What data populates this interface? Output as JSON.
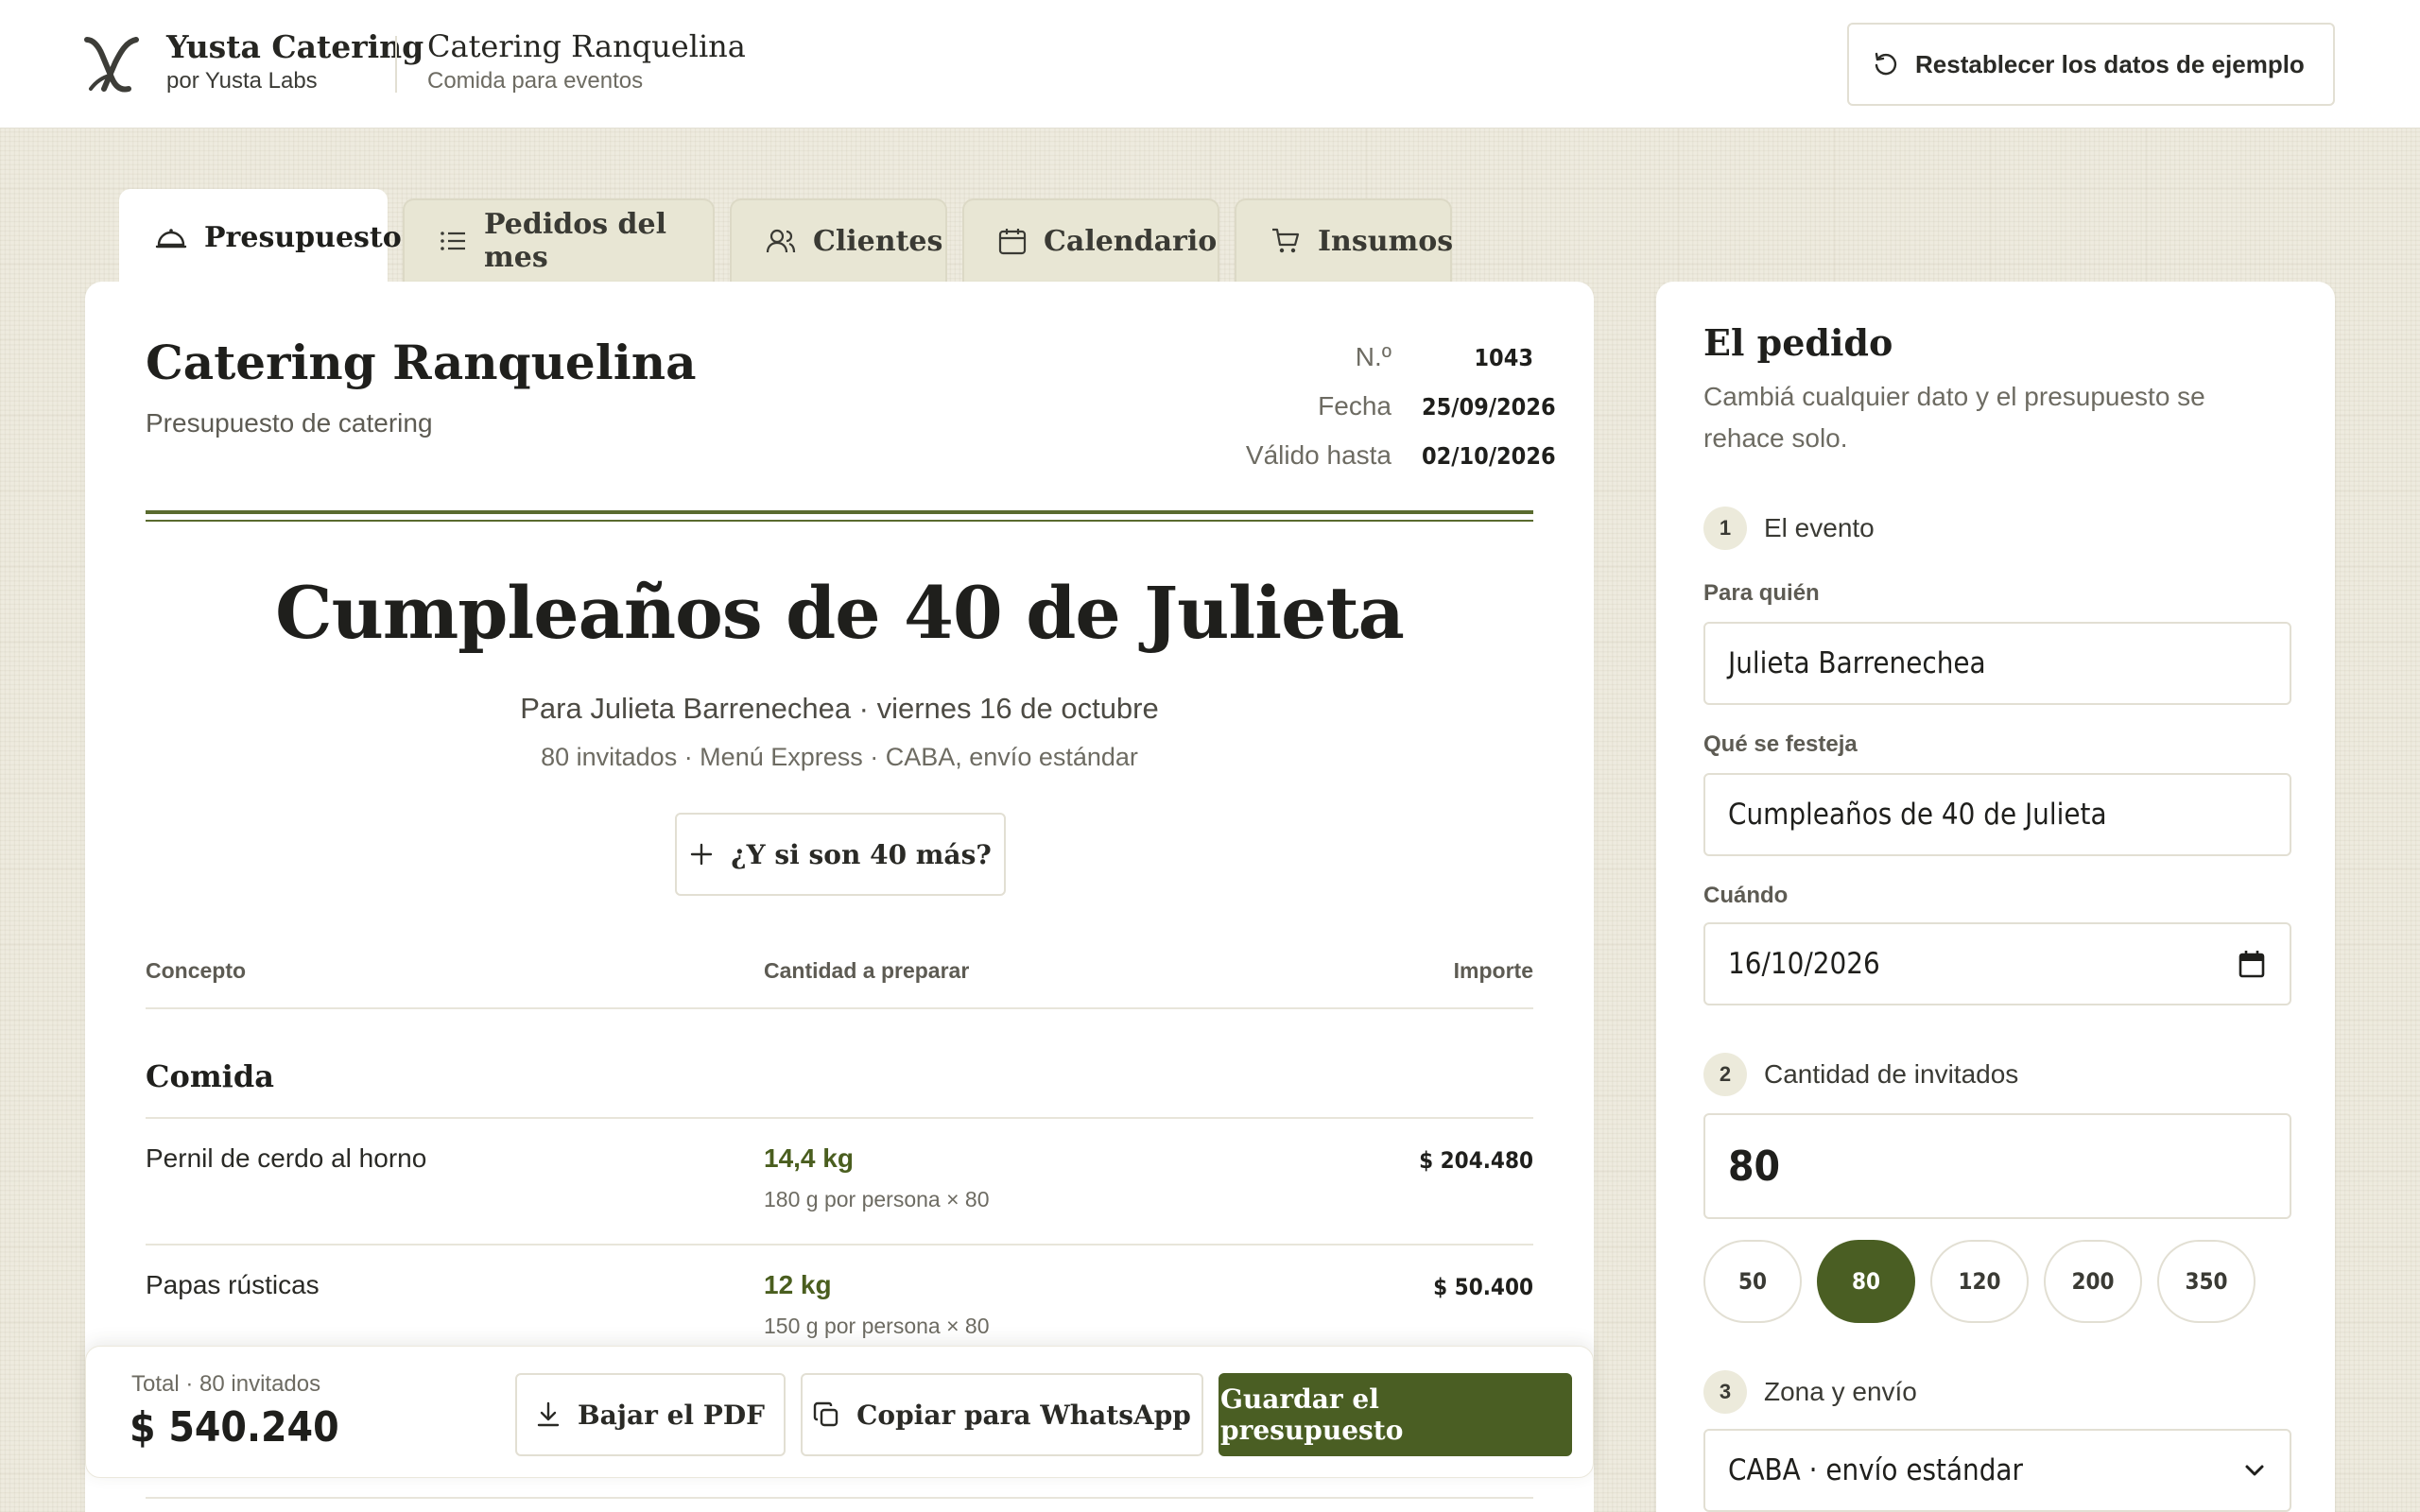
{
  "brand": {
    "name": "Yusta Catering",
    "by": "por Yusta Labs"
  },
  "app": {
    "title": "Catering Ranquelina",
    "subtitle": "Comida para eventos"
  },
  "reset_label": "Restablecer los datos de ejemplo",
  "tabs": [
    {
      "label": "Presupuesto",
      "icon": "cloche-icon",
      "active": true
    },
    {
      "label": "Pedidos del mes",
      "icon": "list-icon",
      "active": false
    },
    {
      "label": "Clientes",
      "icon": "users-icon",
      "active": false
    },
    {
      "label": "Calendario",
      "icon": "calendar-icon",
      "active": false
    },
    {
      "label": "Insumos",
      "icon": "cart-icon",
      "active": false
    }
  ],
  "quote": {
    "company": "Catering Ranquelina",
    "doc_type": "Presupuesto de catering",
    "meta": {
      "number_label": "N.º",
      "number": "1043",
      "date_label": "Fecha",
      "date": "25/09/2026",
      "valid_label": "Válido hasta",
      "valid": "02/10/2026"
    },
    "event_title": "Cumpleaños de 40 de Julieta",
    "event_line1": "Para Julieta Barrenechea · viernes 16 de octubre",
    "event_line2": "80 invitados · Menú Express · CABA, envío estándar",
    "whatif_label": "¿Y si son 40 más?",
    "columns": {
      "concept": "Concepto",
      "qty": "Cantidad a preparar",
      "amount": "Importe"
    },
    "section": "Comida",
    "rows": [
      {
        "concept": "Pernil de cerdo al horno",
        "qty": "14,4 kg",
        "qty_detail": "180 g por persona × 80",
        "amount": "$ 204.480"
      },
      {
        "concept": "Papas rústicas",
        "qty": "12 kg",
        "qty_detail": "150 g por persona × 80",
        "amount": "$ 50.400"
      }
    ]
  },
  "bottom": {
    "total_label": "Total · 80 invitados",
    "total_value": "$ 540.240",
    "pdf_label": "Bajar el PDF",
    "whatsapp_label": "Copiar para WhatsApp",
    "save_label": "Guardar el presupuesto"
  },
  "order": {
    "title": "El pedido",
    "description": "Cambiá cualquier dato y el presupuesto se rehace solo.",
    "step1": {
      "num": "1",
      "label": "El evento"
    },
    "for_label": "Para quién",
    "for_value": "Julieta Barrenechea",
    "what_label": "Qué se festeja",
    "what_value": "Cumpleaños de 40 de Julieta",
    "when_label": "Cuándo",
    "when_value": "16/10/2026",
    "step2": {
      "num": "2",
      "label": "Cantidad de invitados"
    },
    "guests_value": "80",
    "guest_options": [
      "50",
      "80",
      "120",
      "200",
      "350"
    ],
    "guest_selected": "80",
    "step3": {
      "num": "3",
      "label": "Zona y envío"
    },
    "zone_value": "CABA · envío estándar"
  },
  "colors": {
    "accent": "#4a5e23",
    "qty_text": "#4a5e1f",
    "background": "#eeebdf"
  }
}
